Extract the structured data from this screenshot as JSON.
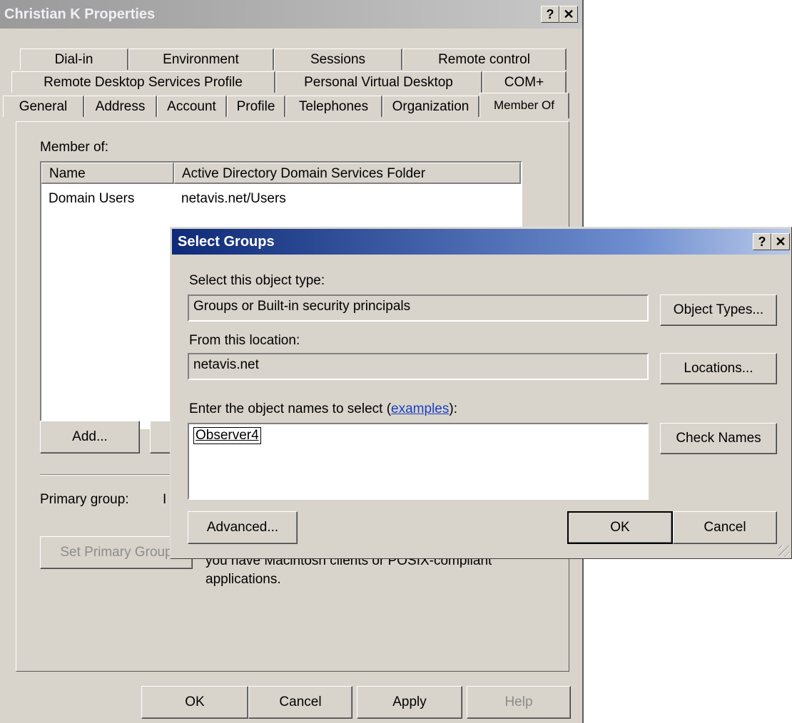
{
  "properties": {
    "title": "Christian K Properties",
    "help_btn": "?",
    "close_btn": "✕",
    "tabs_row1": [
      "Dial-in",
      "Environment",
      "Sessions",
      "Remote control"
    ],
    "tabs_row2": [
      "Remote Desktop Services Profile",
      "Personal Virtual Desktop",
      "COM+"
    ],
    "tabs_row3": [
      "General",
      "Address",
      "Account",
      "Profile",
      "Telephones",
      "Organization",
      "Member Of"
    ],
    "member_of_label": "Member of:",
    "columns": [
      "Name",
      "Active Directory Domain Services Folder"
    ],
    "rows": [
      {
        "name": "Domain Users",
        "folder": "netavis.net/Users"
      }
    ],
    "add_btn": "Add...",
    "primary_group_label": "Primary group:",
    "primary_group_value": "I",
    "set_primary_btn": "Set Primary Group",
    "note_line1": "you have Macintosh clients or POSIX-compliant",
    "note_line2": "applications.",
    "ok": "OK",
    "cancel": "Cancel",
    "apply": "Apply",
    "help": "Help"
  },
  "select_groups": {
    "title": "Select Groups",
    "help_btn": "?",
    "close_btn": "✕",
    "object_type_label": "Select this object type:",
    "object_type_value": "Groups or Built-in security principals",
    "object_types_btn": "Object Types...",
    "location_label": "From this location:",
    "location_value": "netavis.net",
    "locations_btn": "Locations...",
    "names_label_prefix": "Enter the object names to select (",
    "names_label_link": "examples",
    "names_label_suffix": "):",
    "names_value": "Observer4",
    "check_names_btn": "Check Names",
    "advanced_btn": "Advanced...",
    "ok": "OK",
    "cancel": "Cancel"
  }
}
